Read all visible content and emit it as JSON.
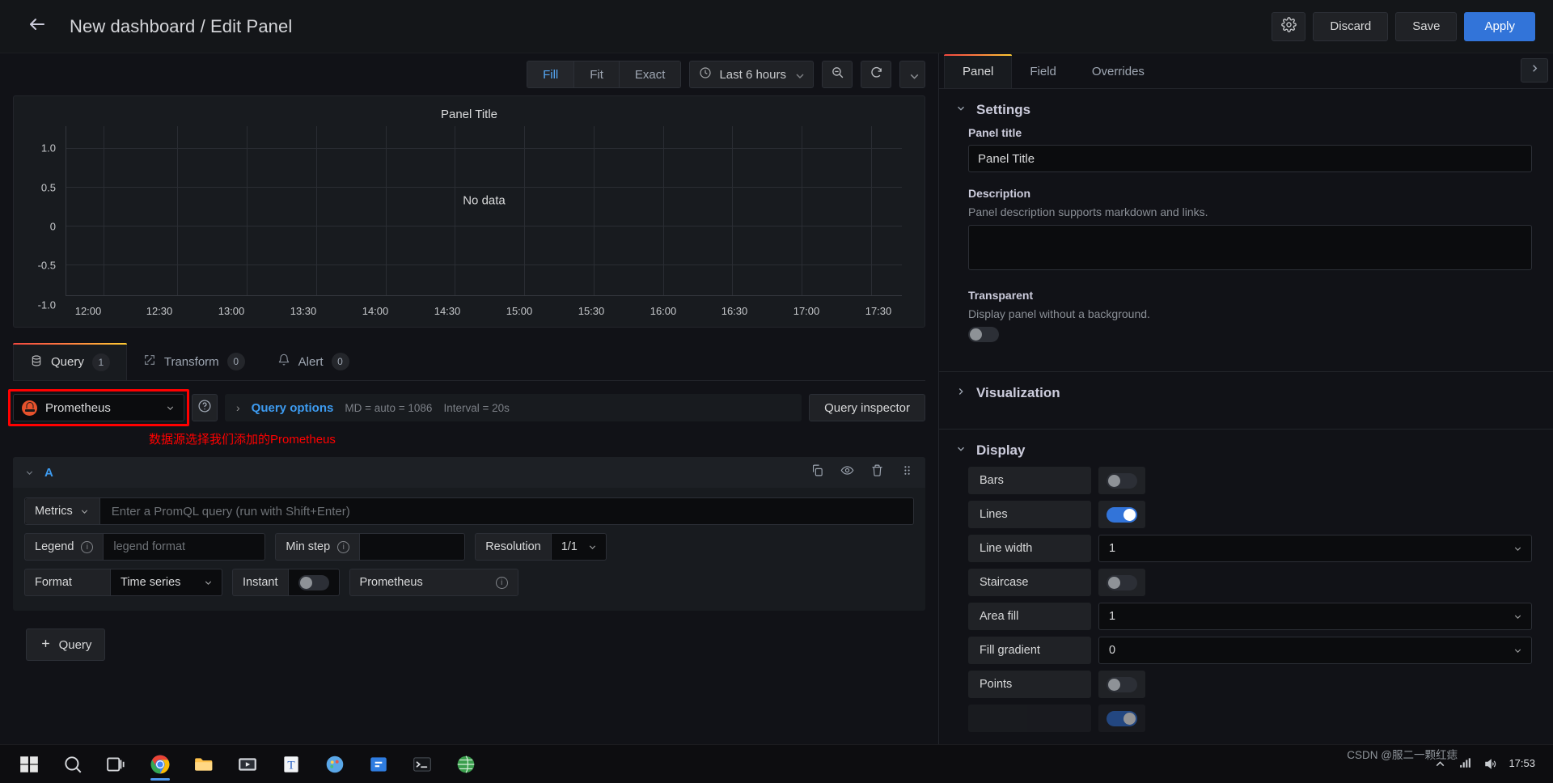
{
  "topbar": {
    "back_icon": "arrow-left-icon",
    "title": "New dashboard / Edit Panel",
    "settings_icon": "gear-icon",
    "discard_label": "Discard",
    "save_label": "Save",
    "apply_label": "Apply",
    "accent_primary": "#3274d9"
  },
  "viz_toolbar": {
    "modes": [
      {
        "label": "Fill",
        "active": true
      },
      {
        "label": "Fit",
        "active": false
      },
      {
        "label": "Exact",
        "active": false
      }
    ],
    "time_range": "Last 6 hours",
    "time_icon": "clock-icon",
    "zoom_out_icon": "zoom-out-icon",
    "refresh_icon": "refresh-icon",
    "refresh_interval_icon": "chevron-down-icon"
  },
  "panel": {
    "title": "Panel Title",
    "no_data_text": "No data"
  },
  "chart_data": {
    "type": "line",
    "title": "Panel Title",
    "series": [],
    "x": [
      "12:00",
      "12:30",
      "13:00",
      "13:30",
      "14:00",
      "14:30",
      "15:00",
      "15:30",
      "16:00",
      "16:30",
      "17:00",
      "17:30"
    ],
    "xlabel": "",
    "ylabel": "",
    "yticks": [
      "1.0",
      "0.5",
      "0",
      "-0.5",
      "-1.0"
    ],
    "ylim": [
      -1.0,
      1.0
    ],
    "grid": true,
    "legend": "none",
    "annotation": "No data"
  },
  "tabs": [
    {
      "label": "Query",
      "count": "1",
      "icon": "database-icon",
      "active": true
    },
    {
      "label": "Transform",
      "count": "0",
      "icon": "transform-icon",
      "active": false
    },
    {
      "label": "Alert",
      "count": "0",
      "icon": "bell-icon",
      "active": false
    }
  ],
  "query": {
    "datasource": "Prometheus",
    "datasource_icon": "prometheus-icon",
    "datasource_chevron": "chevron-down-icon",
    "help_icon": "help-circle-icon",
    "options_arrow": "chevron-right-icon",
    "options_label": "Query options",
    "options_md": "MD = auto = 1086",
    "options_interval": "Interval = 20s",
    "inspector_label": "Query inspector",
    "annotation_cn": "数据源选择我们添加的Prometheus",
    "annotation_color": "#ff0000",
    "highlight_color": "#ff0000",
    "row": {
      "collapse_icon": "chevron-down-icon",
      "ref_id": "A",
      "duplicate_icon": "copy-icon",
      "hide_icon": "eye-icon",
      "delete_icon": "trash-icon",
      "drag_icon": "drag-handle-icon",
      "metrics_label": "Metrics",
      "metrics_chevron": "chevron-down-icon",
      "promql_placeholder": "Enter a PromQL query (run with Shift+Enter)",
      "legend_label": "Legend",
      "legend_info_icon": "info-icon",
      "legend_placeholder": "legend format",
      "minstep_label": "Min step",
      "minstep_info_icon": "info-icon",
      "minstep_value": "",
      "resolution_label": "Resolution",
      "resolution_value": "1/1",
      "format_label": "Format",
      "format_value": "Time series",
      "instant_label": "Instant",
      "instant_on": false,
      "prom_label": "Prometheus",
      "prom_info_icon": "info-icon"
    },
    "add_query_label": "Query",
    "add_icon": "plus-icon"
  },
  "options": {
    "tabs": [
      {
        "label": "Panel",
        "active": true
      },
      {
        "label": "Field",
        "active": false
      },
      {
        "label": "Overrides",
        "active": false
      }
    ],
    "expand_icon": "chevron-right-icon",
    "settings": {
      "section_title": "Settings",
      "collapse_icon": "chevron-down-icon",
      "panel_title_label": "Panel title",
      "panel_title_value": "Panel Title",
      "description_label": "Description",
      "description_help": "Panel description supports markdown and links.",
      "description_value": "",
      "transparent_label": "Transparent",
      "transparent_help": "Display panel without a background.",
      "transparent_on": false
    },
    "visualization": {
      "section_title": "Visualization",
      "expand_icon": "chevron-right-icon"
    },
    "display": {
      "section_title": "Display",
      "collapse_icon": "chevron-down-icon",
      "rows": [
        {
          "label": "Bars",
          "type": "toggle",
          "on": false
        },
        {
          "label": "Lines",
          "type": "toggle",
          "on": true
        },
        {
          "label": "Line width",
          "type": "select",
          "value": "1"
        },
        {
          "label": "Staircase",
          "type": "toggle",
          "on": false
        },
        {
          "label": "Area fill",
          "type": "select",
          "value": "1"
        },
        {
          "label": "Fill gradient",
          "type": "select",
          "value": "0"
        },
        {
          "label": "Points",
          "type": "toggle",
          "on": false
        }
      ]
    }
  },
  "taskbar": {
    "items": [
      "windows-start-icon",
      "search-icon",
      "task-view-icon",
      "chrome-icon",
      "file-explorer-icon",
      "media-player-icon",
      "text-editor-icon",
      "paint-icon",
      "store-icon",
      "terminal-icon",
      "globe-icon"
    ],
    "tray_icons": [
      "chevron-up-icon",
      "network-icon",
      "volume-icon"
    ],
    "clock_time": "17:53",
    "watermark": "CSDN @服二一颗红痣"
  }
}
